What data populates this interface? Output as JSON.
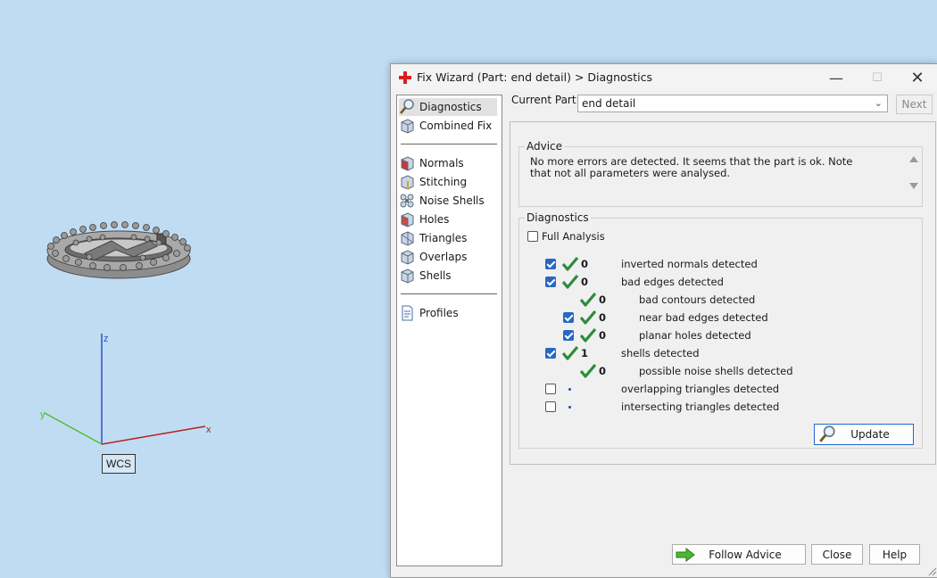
{
  "viewport": {
    "wcs_label": "WCS",
    "axis_x": "x",
    "axis_y": "y",
    "axis_z": "z"
  },
  "dialog": {
    "title": "Fix Wizard (Part: end detail) > Diagnostics",
    "nav": {
      "items_top": [
        "Diagnostics",
        "Combined Fix"
      ],
      "items_mid": [
        "Normals",
        "Stitching",
        "Noise Shells",
        "Holes",
        "Triangles",
        "Overlaps",
        "Shells"
      ],
      "items_bottom": [
        "Profiles"
      ]
    },
    "current_part_label": "Current Part:",
    "current_part_value": "end detail",
    "next_button": "Next",
    "advice": {
      "title": "Advice",
      "text": "No more errors are detected. It seems that the part is ok. Note that not all parameters were analysed."
    },
    "diagnostics": {
      "title": "Diagnostics",
      "full_analysis_label": "Full Analysis",
      "rows": [
        {
          "checked": true,
          "status": "ok",
          "count": "0",
          "label": "inverted normals detected",
          "indent": 0
        },
        {
          "checked": true,
          "status": "ok",
          "count": "0",
          "label": "bad edges detected",
          "indent": 0
        },
        {
          "checkbox": false,
          "status": "ok",
          "count": "0",
          "label": "bad contours detected",
          "indent": 1
        },
        {
          "checked": true,
          "status": "ok",
          "count": "0",
          "label": "near bad edges detected",
          "indent": 1
        },
        {
          "checked": true,
          "status": "ok",
          "count": "0",
          "label": "planar holes detected",
          "indent": 1
        },
        {
          "checked": true,
          "status": "ok",
          "count": "1",
          "label": "shells detected",
          "indent": 0
        },
        {
          "checkbox": false,
          "status": "ok",
          "count": "0",
          "label": "possible noise shells detected",
          "indent": 1
        },
        {
          "checked": false,
          "status": "dot",
          "count": "",
          "label": "overlapping triangles detected",
          "indent": 0
        },
        {
          "checked": false,
          "status": "dot",
          "count": "",
          "label": "intersecting triangles detected",
          "indent": 0
        }
      ],
      "update_button": "Update"
    },
    "buttons": {
      "follow_advice": "Follow Advice",
      "close": "Close",
      "help": "Help"
    }
  },
  "colors": {
    "background": "#c0dcf3",
    "check_green": "#2e8b3a",
    "checkbox_blue": "#2867c4",
    "axis_x": "#b22222",
    "axis_y": "#4cc02c",
    "axis_z": "#2a55c4"
  }
}
